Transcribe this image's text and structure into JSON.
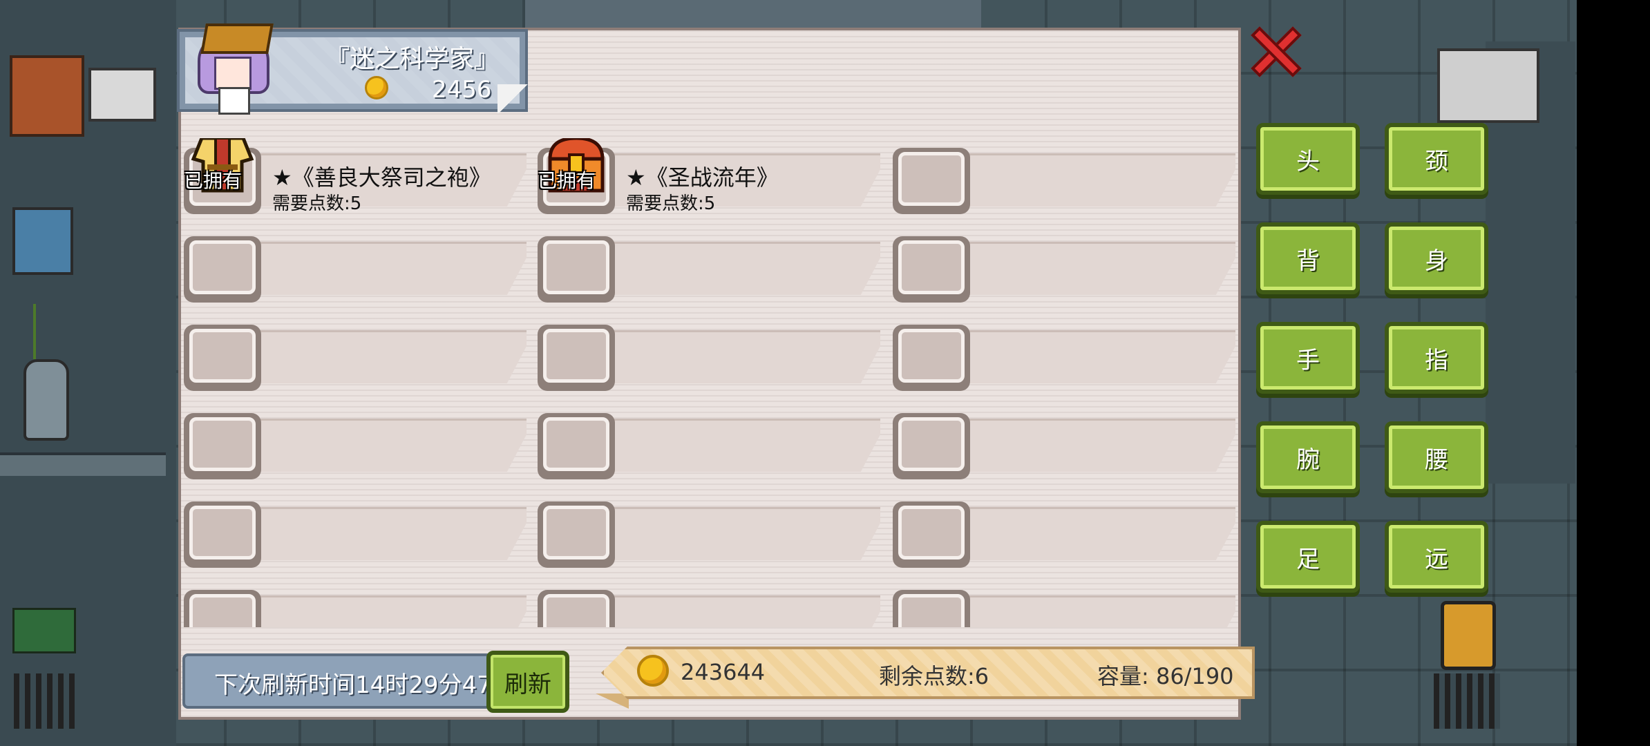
{
  "shop": {
    "title": "『迷之科学家』",
    "coins": "2456",
    "items": [
      {
        "owned_label": "已拥有",
        "name": "★《善良大祭司之袍》",
        "cost": "需要点数:5"
      },
      {
        "owned_label": "已拥有",
        "name": "★《圣战流年》",
        "cost": "需要点数:5"
      }
    ]
  },
  "footer": {
    "refresh_timer": "下次刷新时间14时29分47",
    "refresh_button": "刷新",
    "total_coins": "243644",
    "points_left": "剩余点数:6",
    "capacity": "容量:  86/190"
  },
  "categories": [
    "头",
    "颈",
    "背",
    "身",
    "手",
    "指",
    "腕",
    "腰",
    "足",
    "远"
  ],
  "colors": {
    "button_green": "#8bb53b",
    "panel_bg": "#ebe3e0",
    "header_blue": "#8294a8",
    "stats_bar": "#f1d39c",
    "close_red": "#e03030"
  },
  "icons": {
    "close": "close-icon",
    "coin": "coin-icon",
    "robe": "robe-icon",
    "chest": "treasure-chest-icon"
  }
}
